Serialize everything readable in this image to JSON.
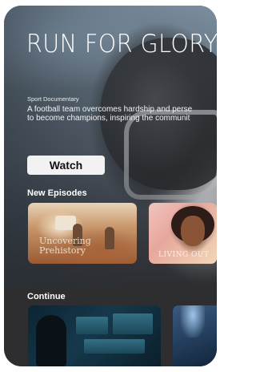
{
  "hero": {
    "title": "RUN FOR GLORY",
    "category": "Sport Documentary",
    "description_line1": "A football team overcomes hardship and perse",
    "description_line2": "to become champions, inspiring the communit",
    "watch_label": "Watch"
  },
  "new_episodes": {
    "heading": "New Episodes",
    "items": [
      {
        "overlay_text": "Uncovering Prehistory"
      },
      {
        "overlay_text": "LIVING OUT"
      }
    ]
  },
  "continue": {
    "heading": "Continue"
  }
}
